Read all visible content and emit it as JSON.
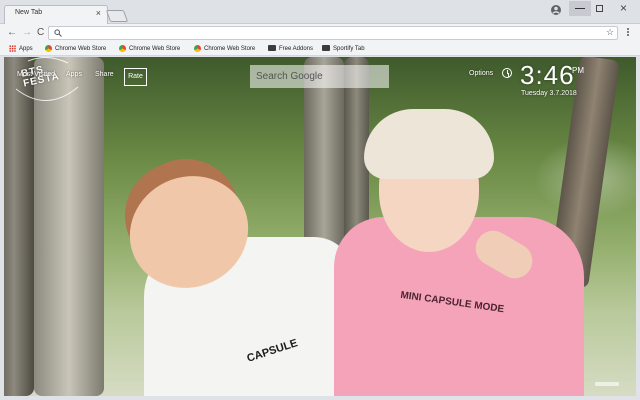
{
  "window": {
    "tab_title": "New Tab",
    "close_glyph": "×"
  },
  "toolbar": {
    "back_glyph": "←",
    "forward_glyph": "→",
    "reload_glyph": "C",
    "star_glyph": "☆"
  },
  "bookmarks": [
    {
      "label": "Apps",
      "icon": "apps-grid-icon"
    },
    {
      "label": "Chrome Web Store",
      "icon": "chrome-web-store-icon"
    },
    {
      "label": "Chrome Web Store",
      "icon": "chrome-web-store-icon"
    },
    {
      "label": "Chrome Web Store",
      "icon": "chrome-web-store-icon"
    },
    {
      "label": "Free Addons",
      "icon": "addon-icon"
    },
    {
      "label": "Sportify Tab",
      "icon": "addon-icon"
    }
  ],
  "newtab": {
    "logo_text": "BTS FESTA",
    "links": {
      "most_visited": "Most Visited",
      "apps": "Apps",
      "share": "Share",
      "rate": "Rate"
    },
    "search_placeholder": "Search Google",
    "options": "Options",
    "time": "3:46",
    "ampm": "PM",
    "date": "Tuesday  3.7.2018"
  },
  "photo": {
    "shirt_text_1": "CAPSULE",
    "shirt_text_2": "MINI CAPSULE MODE"
  },
  "colors": {
    "tab_bar": "#dee1e6",
    "toolbar": "#f2f3f5",
    "shirt_pink": "#f5a3b9"
  }
}
